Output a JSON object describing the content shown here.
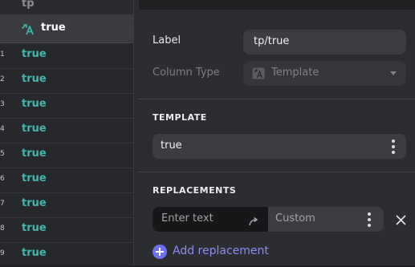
{
  "grid": {
    "header_title": "tp",
    "column": {
      "name": "true",
      "icon": "template-icon"
    },
    "rows": [
      {
        "num": "1",
        "value": "true"
      },
      {
        "num": "2",
        "value": "true"
      },
      {
        "num": "3",
        "value": "true"
      },
      {
        "num": "4",
        "value": "true"
      },
      {
        "num": "5",
        "value": "true"
      },
      {
        "num": "6",
        "value": "true"
      },
      {
        "num": "7",
        "value": "true"
      },
      {
        "num": "8",
        "value": "true"
      },
      {
        "num": "9",
        "value": "true"
      }
    ]
  },
  "panel": {
    "label_caption": "Label",
    "label_value": "tp/true",
    "column_type_caption": "Column Type",
    "column_type_value": "Template",
    "template_section": "TEMPLATE",
    "template_value": "true",
    "replacements_section": "REPLACEMENTS",
    "replacement": {
      "find_placeholder": "Enter text",
      "replace_placeholder": "Custom"
    },
    "add_replacement_label": "Add replacement"
  },
  "colors": {
    "accent": "#6f6ff2",
    "cell_text": "#45b5ad"
  }
}
